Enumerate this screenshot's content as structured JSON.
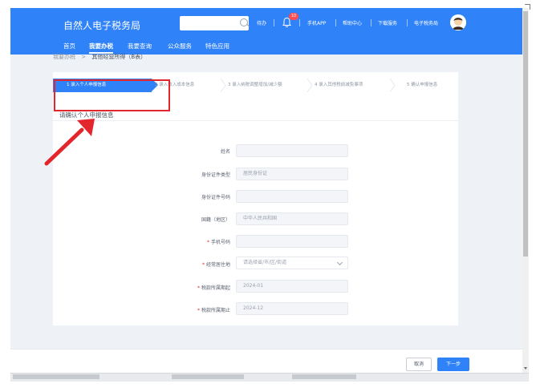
{
  "app": {
    "title": "自然人电子税务局"
  },
  "header": {
    "todo": "待办",
    "badge": "10",
    "tools": [
      "手机APP",
      "帮助中心",
      "下载服务",
      "电子税务局"
    ]
  },
  "nav": {
    "items": [
      "首页",
      "我要办税",
      "我要查询",
      "公众服务",
      "特色应用"
    ]
  },
  "breadcrumb": {
    "parent": "我要办税",
    "separator": ">",
    "current": "其他经营所得（B表）"
  },
  "steps": [
    "1  录入个人申报信息",
    "2  录入收入成本信息",
    "3  录入纳税调整增加/减少额",
    "4  录入其他税前减免事项",
    "5  确认申报信息"
  ],
  "form": {
    "section_title": "请确认个人申报信息",
    "fields": [
      {
        "label": "姓名",
        "required": false,
        "value": ""
      },
      {
        "label": "身份证件类型",
        "required": false,
        "value": "居民身份证"
      },
      {
        "label": "身份证件号码",
        "required": false,
        "value": ""
      },
      {
        "label": "国籍（地区）",
        "required": false,
        "value": "中华人民共和国"
      },
      {
        "label": "手机号码",
        "required": true,
        "value": ""
      },
      {
        "label": "经常居住地",
        "required": true,
        "placeholder": "请选择省/市/区/街道"
      },
      {
        "label": "税款所属期起",
        "required": true,
        "value": "2024-01"
      },
      {
        "label": "税款所属期止",
        "required": true,
        "value": "2024-12"
      }
    ]
  },
  "footer": {
    "cancel": "取消",
    "next": "下一步"
  },
  "colors": {
    "primary": "#2f82f7",
    "annotation": "#e3262b",
    "required": "#f5222d"
  }
}
